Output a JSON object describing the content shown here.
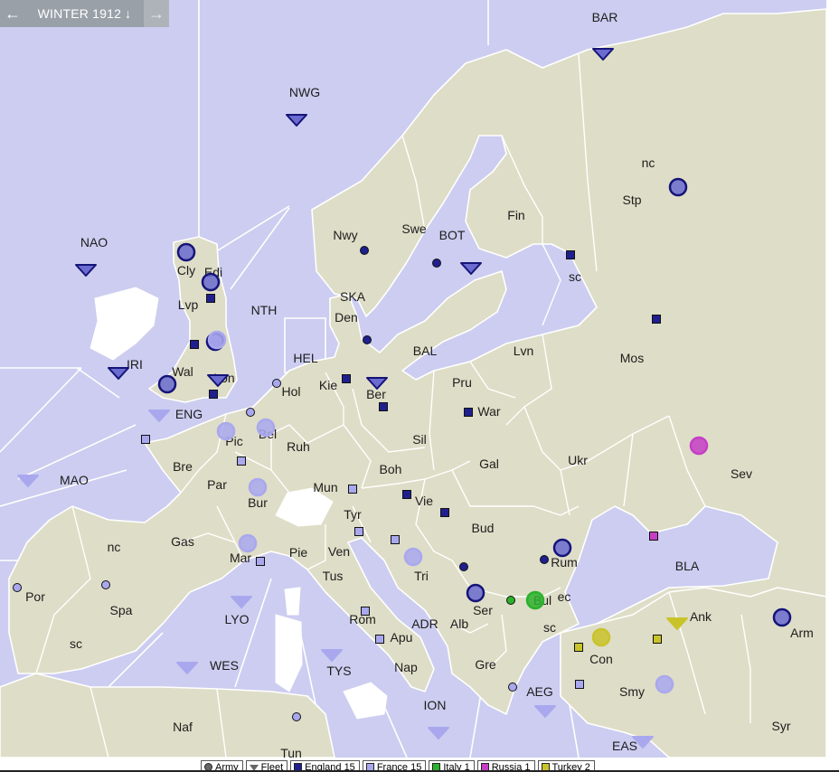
{
  "phase": {
    "label": "WINTER 1912",
    "prev_icon": "arrow-left-icon",
    "next_icon": "arrow-right-icon",
    "dropdown_icon": "arrow-down-icon"
  },
  "colors": {
    "sea": "#cccdf0",
    "land": "#deddc7",
    "border": "#ffffff",
    "england": "#1f1f8f",
    "france": "#a9a8ee",
    "italy": "#2bb12b",
    "russia": "#c53ec5",
    "turkey": "#c9c32a"
  },
  "provinces": [
    {
      "id": "BAR",
      "label": "BAR"
    },
    {
      "id": "NWG",
      "label": "NWG"
    },
    {
      "id": "nc_stp",
      "label": "nc"
    },
    {
      "id": "Stp",
      "label": "Stp"
    },
    {
      "id": "Fin",
      "label": "Fin"
    },
    {
      "id": "Nwy",
      "label": "Nwy"
    },
    {
      "id": "Swe",
      "label": "Swe"
    },
    {
      "id": "BOT",
      "label": "BOT"
    },
    {
      "id": "NAO",
      "label": "NAO"
    },
    {
      "id": "Cly",
      "label": "Cly"
    },
    {
      "id": "Edi",
      "label": "Edi"
    },
    {
      "id": "sc_stp",
      "label": "sc"
    },
    {
      "id": "SKA",
      "label": "SKA"
    },
    {
      "id": "Lvp",
      "label": "Lvp"
    },
    {
      "id": "NTH",
      "label": "NTH"
    },
    {
      "id": "Den",
      "label": "Den"
    },
    {
      "id": "BAL",
      "label": "BAL"
    },
    {
      "id": "Lvn",
      "label": "Lvn"
    },
    {
      "id": "Mos",
      "label": "Mos"
    },
    {
      "id": "HEL",
      "label": "HEL"
    },
    {
      "id": "Yor",
      "label": "Yor"
    },
    {
      "id": "IRI",
      "label": "IRI"
    },
    {
      "id": "Wal",
      "label": "Wal"
    },
    {
      "id": "Lon",
      "label": "Lon"
    },
    {
      "id": "Kie",
      "label": "Kie"
    },
    {
      "id": "Pru",
      "label": "Pru"
    },
    {
      "id": "Hol",
      "label": "Hol"
    },
    {
      "id": "Ber",
      "label": "Ber"
    },
    {
      "id": "War",
      "label": "War"
    },
    {
      "id": "ENG",
      "label": "ENG"
    },
    {
      "id": "Bel",
      "label": "Bel"
    },
    {
      "id": "Pic",
      "label": "Pic"
    },
    {
      "id": "Ruh",
      "label": "Ruh"
    },
    {
      "id": "Sil",
      "label": "Sil"
    },
    {
      "id": "Ukr",
      "label": "Ukr"
    },
    {
      "id": "Sev",
      "label": "Sev"
    },
    {
      "id": "Bre",
      "label": "Bre"
    },
    {
      "id": "Gal",
      "label": "Gal"
    },
    {
      "id": "Boh",
      "label": "Boh"
    },
    {
      "id": "MAO",
      "label": "MAO"
    },
    {
      "id": "Par",
      "label": "Par"
    },
    {
      "id": "Mun",
      "label": "Mun"
    },
    {
      "id": "Bur",
      "label": "Bur"
    },
    {
      "id": "Vie",
      "label": "Vie"
    },
    {
      "id": "Tyr",
      "label": "Tyr"
    },
    {
      "id": "Bud",
      "label": "Bud"
    },
    {
      "id": "Gas",
      "label": "Gas"
    },
    {
      "id": "nc_spa",
      "label": "nc"
    },
    {
      "id": "Mar",
      "label": "Mar"
    },
    {
      "id": "Pie",
      "label": "Pie"
    },
    {
      "id": "Ven",
      "label": "Ven"
    },
    {
      "id": "Rum",
      "label": "Rum"
    },
    {
      "id": "BLA",
      "label": "BLA"
    },
    {
      "id": "Tri",
      "label": "Tri"
    },
    {
      "id": "Tus",
      "label": "Tus"
    },
    {
      "id": "Por",
      "label": "Por"
    },
    {
      "id": "Spa",
      "label": "Spa"
    },
    {
      "id": "ec_bul",
      "label": "ec"
    },
    {
      "id": "Ser",
      "label": "Ser"
    },
    {
      "id": "Bul",
      "label": "Bul"
    },
    {
      "id": "LYO",
      "label": "LYO"
    },
    {
      "id": "Rom",
      "label": "Rom"
    },
    {
      "id": "Ank",
      "label": "Ank"
    },
    {
      "id": "ADR",
      "label": "ADR"
    },
    {
      "id": "Alb",
      "label": "Alb"
    },
    {
      "id": "sc_bul",
      "label": "sc"
    },
    {
      "id": "Arm",
      "label": "Arm"
    },
    {
      "id": "sc_spa",
      "label": "sc"
    },
    {
      "id": "Apu",
      "label": "Apu"
    },
    {
      "id": "Con",
      "label": "Con"
    },
    {
      "id": "WES",
      "label": "WES"
    },
    {
      "id": "TYS",
      "label": "TYS"
    },
    {
      "id": "Nap",
      "label": "Nap"
    },
    {
      "id": "Gre",
      "label": "Gre"
    },
    {
      "id": "Smy",
      "label": "Smy"
    },
    {
      "id": "AEG",
      "label": "AEG"
    },
    {
      "id": "ION",
      "label": "ION"
    },
    {
      "id": "Naf",
      "label": "Naf"
    },
    {
      "id": "Syr",
      "label": "Syr"
    },
    {
      "id": "EAS",
      "label": "EAS"
    },
    {
      "id": "Tun",
      "label": "Tun"
    }
  ],
  "units": [
    {
      "power": "england",
      "type": "fleet",
      "at": "BAR"
    },
    {
      "power": "england",
      "type": "fleet",
      "at": "NWG"
    },
    {
      "power": "england",
      "type": "fleet",
      "at": "NAO"
    },
    {
      "power": "england",
      "type": "fleet",
      "at": "BOT"
    },
    {
      "power": "england",
      "type": "fleet",
      "at": "IRI"
    },
    {
      "power": "england",
      "type": "fleet",
      "at": "Lon"
    },
    {
      "power": "england",
      "type": "fleet",
      "at": "Ber"
    },
    {
      "power": "england",
      "type": "army",
      "at": "Stp"
    },
    {
      "power": "england",
      "type": "army",
      "at": "Cly"
    },
    {
      "power": "england",
      "type": "army",
      "at": "Edi"
    },
    {
      "power": "england",
      "type": "army",
      "at": "Yor"
    },
    {
      "power": "england",
      "type": "army",
      "at": "Wal"
    },
    {
      "power": "england",
      "type": "army",
      "at": "Rum"
    },
    {
      "power": "england",
      "type": "army",
      "at": "Ser"
    },
    {
      "power": "england",
      "type": "army",
      "at": "Arm"
    },
    {
      "power": "france",
      "type": "fleet",
      "at": "ENG"
    },
    {
      "power": "france",
      "type": "fleet",
      "at": "MAO"
    },
    {
      "power": "france",
      "type": "fleet",
      "at": "LYO"
    },
    {
      "power": "france",
      "type": "fleet",
      "at": "WES"
    },
    {
      "power": "france",
      "type": "fleet",
      "at": "TYS"
    },
    {
      "power": "france",
      "type": "fleet",
      "at": "AEG"
    },
    {
      "power": "france",
      "type": "fleet",
      "at": "ION"
    },
    {
      "power": "france",
      "type": "fleet",
      "at": "EAS"
    },
    {
      "power": "france",
      "type": "army",
      "at": "Pic"
    },
    {
      "power": "france",
      "type": "army",
      "at": "Bel"
    },
    {
      "power": "france",
      "type": "army",
      "at": "Bur"
    },
    {
      "power": "france",
      "type": "army",
      "at": "Mar"
    },
    {
      "power": "france",
      "type": "army",
      "at": "Tri"
    },
    {
      "power": "france",
      "type": "army",
      "at": "Smy"
    },
    {
      "power": "france",
      "type": "army",
      "at": "Lon"
    },
    {
      "power": "italy",
      "type": "army",
      "at": "Bul"
    },
    {
      "power": "russia",
      "type": "army",
      "at": "Sev"
    },
    {
      "power": "turkey",
      "type": "army",
      "at": "Con"
    },
    {
      "power": "turkey",
      "type": "fleet",
      "at": "Ank"
    }
  ],
  "supply_centers": [
    {
      "at": "Nwy",
      "owner": "england"
    },
    {
      "at": "Swe",
      "owner": "england"
    },
    {
      "at": "Stp",
      "owner": "england"
    },
    {
      "at": "Edi",
      "owner": "england"
    },
    {
      "at": "Lvp",
      "owner": "england"
    },
    {
      "at": "Lon",
      "owner": "england"
    },
    {
      "at": "Den",
      "owner": "england"
    },
    {
      "at": "Mos",
      "owner": "england"
    },
    {
      "at": "Kie",
      "owner": "england"
    },
    {
      "at": "Ber",
      "owner": "england"
    },
    {
      "at": "War",
      "owner": "england"
    },
    {
      "at": "Vie",
      "owner": "england"
    },
    {
      "at": "Bud",
      "owner": "england"
    },
    {
      "at": "Rum",
      "owner": "england"
    },
    {
      "at": "Ser",
      "owner": "england"
    },
    {
      "at": "Hol",
      "owner": "france"
    },
    {
      "at": "Bel",
      "owner": "france"
    },
    {
      "at": "Bre",
      "owner": "france"
    },
    {
      "at": "Par",
      "owner": "france"
    },
    {
      "at": "Mun",
      "owner": "france"
    },
    {
      "at": "Mar",
      "owner": "france"
    },
    {
      "at": "Spa",
      "owner": "france"
    },
    {
      "at": "Por",
      "owner": "france"
    },
    {
      "at": "Ven",
      "owner": "france"
    },
    {
      "at": "Tri",
      "owner": "france"
    },
    {
      "at": "Rom",
      "owner": "france"
    },
    {
      "at": "Nap",
      "owner": "france"
    },
    {
      "at": "Tun",
      "owner": "france"
    },
    {
      "at": "Gre",
      "owner": "france"
    },
    {
      "at": "Smy",
      "owner": "france"
    },
    {
      "at": "Bul",
      "owner": "italy"
    },
    {
      "at": "Sev",
      "owner": "russia"
    },
    {
      "at": "Con",
      "owner": "turkey"
    },
    {
      "at": "Ank",
      "owner": "turkey"
    }
  ],
  "legend": [
    {
      "key": "army",
      "label": "Army",
      "swatch": "#666666"
    },
    {
      "key": "fleet",
      "label": "Fleet",
      "swatch": "#666666"
    },
    {
      "key": "england",
      "label": "England 15",
      "swatch": "#1f1f8f"
    },
    {
      "key": "france",
      "label": "France 15",
      "swatch": "#a9a8ee"
    },
    {
      "key": "italy",
      "label": "Italy 1",
      "swatch": "#2bb12b"
    },
    {
      "key": "russia",
      "label": "Russia 1",
      "swatch": "#c53ec5"
    },
    {
      "key": "turkey",
      "label": "Turkey 2",
      "swatch": "#c9c32a"
    }
  ]
}
